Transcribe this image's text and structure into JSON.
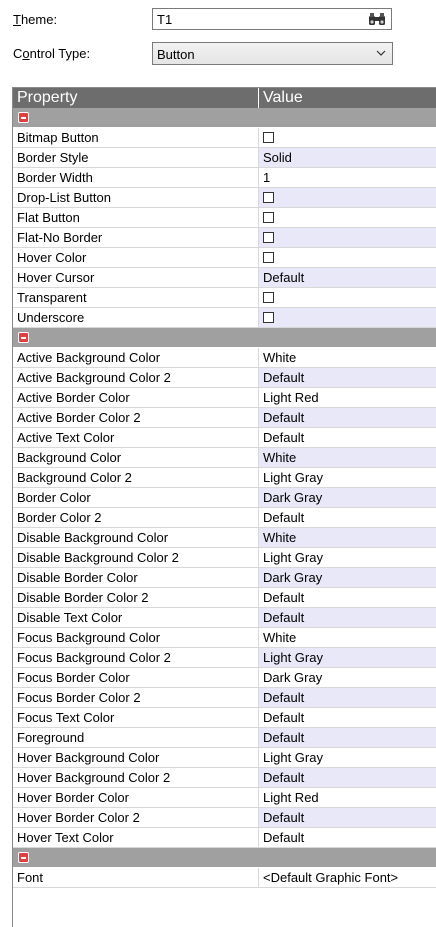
{
  "form": {
    "theme_label_u": "T",
    "theme_label_rest": "heme:",
    "theme_value": "T1",
    "control_type_label_pre": "C",
    "control_type_label_u": "o",
    "control_type_label_rest": "ntrol Type:",
    "control_type_value": "Button"
  },
  "grid": {
    "col_property": "Property",
    "col_value": "Value",
    "sections": [
      {
        "rows": [
          {
            "name": "Bitmap Button",
            "value": "",
            "type": "checkbox"
          },
          {
            "name": "Border Style",
            "value": "Solid",
            "type": "text"
          },
          {
            "name": "Border Width",
            "value": "1",
            "type": "text"
          },
          {
            "name": "Drop-List Button",
            "value": "",
            "type": "checkbox"
          },
          {
            "name": "Flat Button",
            "value": "",
            "type": "checkbox"
          },
          {
            "name": "Flat-No Border",
            "value": "",
            "type": "checkbox"
          },
          {
            "name": "Hover Color",
            "value": "",
            "type": "checkbox"
          },
          {
            "name": "Hover Cursor",
            "value": "Default",
            "type": "text"
          },
          {
            "name": "Transparent",
            "value": "",
            "type": "checkbox"
          },
          {
            "name": "Underscore",
            "value": "",
            "type": "checkbox"
          }
        ]
      },
      {
        "rows": [
          {
            "name": "Active Background Color",
            "value": "White",
            "type": "text"
          },
          {
            "name": "Active Background Color 2",
            "value": "Default",
            "type": "text"
          },
          {
            "name": "Active Border Color",
            "value": "Light Red",
            "type": "text"
          },
          {
            "name": "Active Border Color 2",
            "value": "Default",
            "type": "text"
          },
          {
            "name": "Active Text Color",
            "value": "Default",
            "type": "text"
          },
          {
            "name": "Background Color",
            "value": "White",
            "type": "text"
          },
          {
            "name": "Background Color 2",
            "value": "Light Gray",
            "type": "text"
          },
          {
            "name": "Border Color",
            "value": "Dark Gray",
            "type": "text"
          },
          {
            "name": "Border Color 2",
            "value": "Default",
            "type": "text"
          },
          {
            "name": "Disable Background Color",
            "value": "White",
            "type": "text"
          },
          {
            "name": "Disable Background Color 2",
            "value": "Light Gray",
            "type": "text"
          },
          {
            "name": "Disable Border Color",
            "value": "Dark Gray",
            "type": "text"
          },
          {
            "name": "Disable Border Color 2",
            "value": "Default",
            "type": "text"
          },
          {
            "name": "Disable Text Color",
            "value": "Default",
            "type": "text"
          },
          {
            "name": "Focus Background Color",
            "value": "White",
            "type": "text"
          },
          {
            "name": "Focus Background Color 2",
            "value": "Light Gray",
            "type": "text"
          },
          {
            "name": "Focus Border Color",
            "value": "Dark Gray",
            "type": "text"
          },
          {
            "name": "Focus Border Color 2",
            "value": "Default",
            "type": "text"
          },
          {
            "name": "Focus Text Color",
            "value": "Default",
            "type": "text"
          },
          {
            "name": "Foreground",
            "value": "Default",
            "type": "text"
          },
          {
            "name": "Hover Background Color",
            "value": "Light Gray",
            "type": "text"
          },
          {
            "name": "Hover Background Color 2",
            "value": "Default",
            "type": "text"
          },
          {
            "name": "Hover Border Color",
            "value": "Light Red",
            "type": "text"
          },
          {
            "name": "Hover Border Color 2",
            "value": "Default",
            "type": "text"
          },
          {
            "name": "Hover Text Color",
            "value": "Default",
            "type": "text"
          }
        ]
      },
      {
        "rows": [
          {
            "name": "Font",
            "value": "<Default Graphic Font>",
            "type": "text"
          }
        ]
      }
    ]
  },
  "colors": {
    "header_bg": "#6d6d6d",
    "category_bg": "#a0a0a0",
    "alt_value_bg": "#e8e8f8",
    "collapse_icon": "#e04040"
  }
}
